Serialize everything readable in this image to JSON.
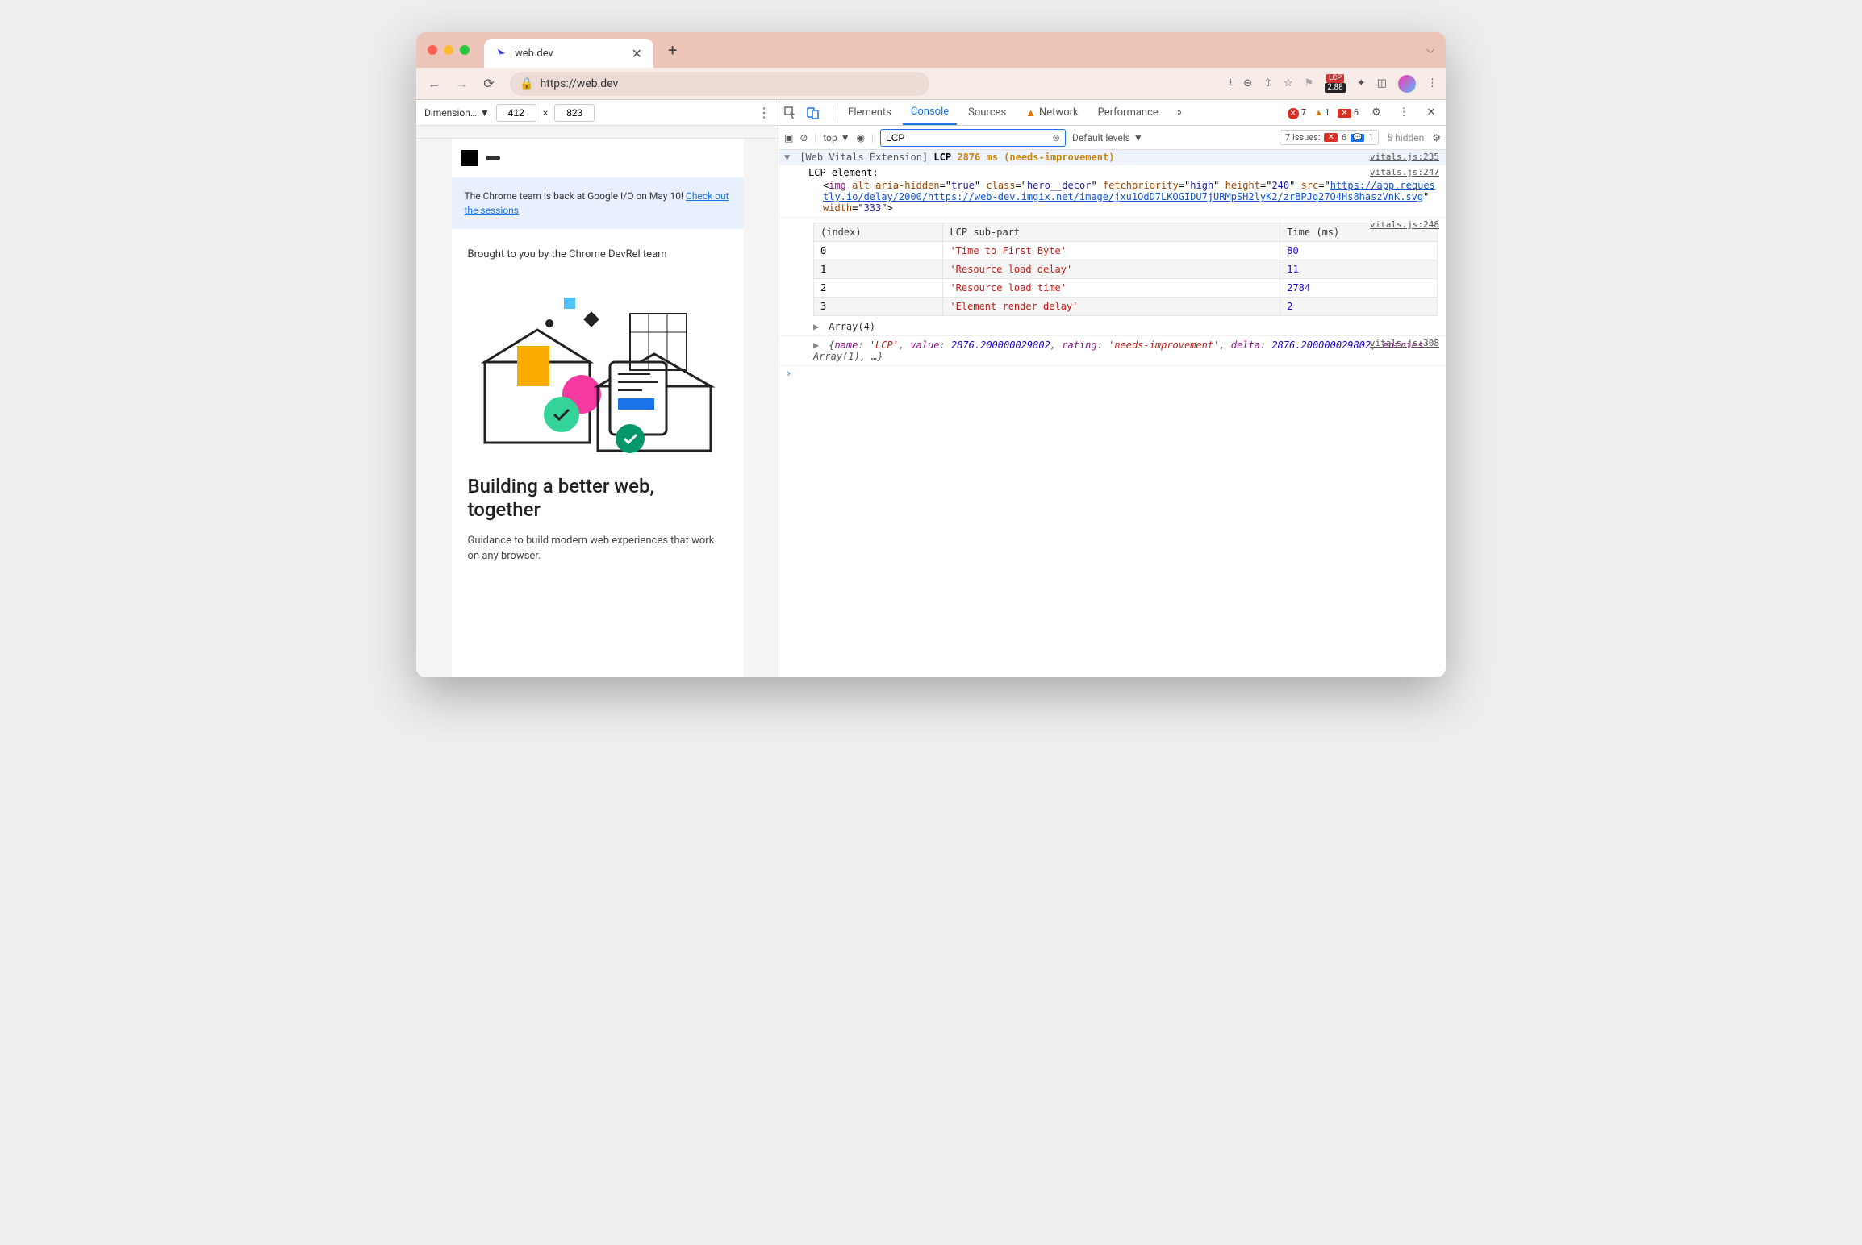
{
  "tab": {
    "title": "web.dev"
  },
  "url": {
    "display": "https://web.dev"
  },
  "extension": {
    "label": "LCP",
    "value": "2.88"
  },
  "deviceBar": {
    "label": "Dimension…",
    "width": "412",
    "height": "823",
    "separator": "×"
  },
  "preview": {
    "bannerText": "The Chrome team is back at Google I/O on May 10! ",
    "bannerLink": "Check out the sessions",
    "kicker": "Brought to you by the Chrome DevRel team",
    "heading": "Building a better web, together",
    "sub": "Guidance to build modern web experiences that work on any browser."
  },
  "devtools": {
    "tabs": [
      "Elements",
      "Console",
      "Sources",
      "Network",
      "Performance"
    ],
    "activeTab": "Console",
    "errors": "7",
    "warnings": "1",
    "blocked": "6",
    "consoleBar": {
      "context": "top",
      "filter": "LCP",
      "levels": "Default levels",
      "issuesLabel": "7 Issues:",
      "issuesErr": "6",
      "issuesInfo": "1",
      "hidden": "5 hidden"
    }
  },
  "log": {
    "header": {
      "prefix": "[Web Vitals Extension]",
      "metric": "LCP",
      "value": "2876 ms",
      "rating": "(needs-improvement)",
      "source": "vitals.js:235"
    },
    "element": {
      "label": "LCP element:",
      "source": "vitals.js:247",
      "tag": "img",
      "alt": "",
      "ariaHidden": "true",
      "class": "hero__decor",
      "fetchpriority": "high",
      "height": "240",
      "srcPrefix": "https://app.requestly.io/delay/2000/https://web-dev.imgix.net/image/jxu1OdD7LKOGIDU7jURMpSH2lyK2/zrBPJq27O4Hs8haszVnK.svg",
      "width": "333"
    },
    "tableSource": "vitals.js:248",
    "tableHeaders": [
      "(index)",
      "LCP sub-part",
      "Time (ms)"
    ],
    "tableRows": [
      {
        "idx": "0",
        "part": "'Time to First Byte'",
        "time": "80"
      },
      {
        "idx": "1",
        "part": "'Resource load delay'",
        "time": "11"
      },
      {
        "idx": "2",
        "part": "'Resource load time'",
        "time": "2784"
      },
      {
        "idx": "3",
        "part": "'Element render delay'",
        "time": "2"
      }
    ],
    "arrayLabel": "Array(4)",
    "objSource": "vitals.js:308",
    "obj": {
      "name": "'LCP'",
      "value": "2876.200000029802",
      "rating": "'needs-improvement'",
      "delta": "2876.200000029802",
      "entries": "Array(1)"
    }
  }
}
